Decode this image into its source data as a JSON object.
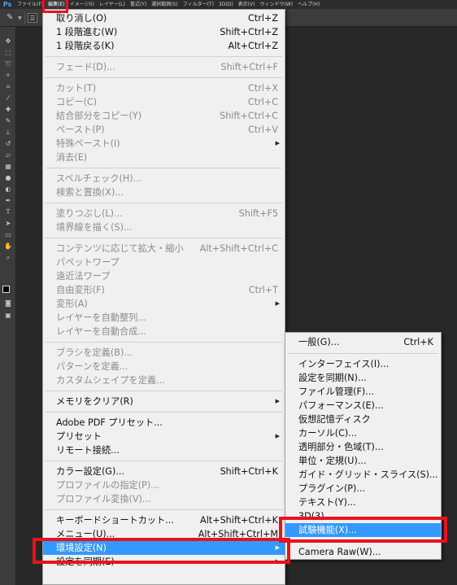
{
  "app": {
    "logo": "Ps"
  },
  "menubar": [
    {
      "label": "ファイル(F)"
    },
    {
      "label": "編集(E)",
      "active": true
    },
    {
      "label": "イメージ(I)"
    },
    {
      "label": "レイヤー(L)"
    },
    {
      "label": "書式(Y)"
    },
    {
      "label": "選択範囲(S)"
    },
    {
      "label": "フィルター(T)"
    },
    {
      "label": "3D(D)"
    },
    {
      "label": "表示(V)"
    },
    {
      "label": "ウィンドウ(W)"
    },
    {
      "label": "ヘルプ(H)"
    }
  ],
  "edit_menu": {
    "items": [
      {
        "label": "取り消し(O)",
        "shortcut": "Ctrl+Z"
      },
      {
        "label": "1 段階進む(W)",
        "shortcut": "Shift+Ctrl+Z"
      },
      {
        "label": "1 段階戻る(K)",
        "shortcut": "Alt+Ctrl+Z"
      },
      {
        "sep": true
      },
      {
        "label": "フェード(D)...",
        "shortcut": "Shift+Ctrl+F",
        "disabled": true
      },
      {
        "sep": true
      },
      {
        "label": "カット(T)",
        "shortcut": "Ctrl+X",
        "disabled": true
      },
      {
        "label": "コピー(C)",
        "shortcut": "Ctrl+C",
        "disabled": true
      },
      {
        "label": "結合部分をコピー(Y)",
        "shortcut": "Shift+Ctrl+C",
        "disabled": true
      },
      {
        "label": "ペースト(P)",
        "shortcut": "Ctrl+V",
        "disabled": true
      },
      {
        "label": "特殊ペースト(I)",
        "submenu": true,
        "disabled": true
      },
      {
        "label": "消去(E)",
        "disabled": true
      },
      {
        "sep": true
      },
      {
        "label": "スペルチェック(H)...",
        "disabled": true
      },
      {
        "label": "検索と置換(X)...",
        "disabled": true
      },
      {
        "sep": true
      },
      {
        "label": "塗りつぶし(L)...",
        "shortcut": "Shift+F5",
        "disabled": true
      },
      {
        "label": "境界線を描く(S)...",
        "disabled": true
      },
      {
        "sep": true
      },
      {
        "label": "コンテンツに応じて拡大・縮小",
        "shortcut": "Alt+Shift+Ctrl+C",
        "disabled": true
      },
      {
        "label": "パペットワープ",
        "disabled": true
      },
      {
        "label": "遠近法ワープ",
        "disabled": true
      },
      {
        "label": "自由変形(F)",
        "shortcut": "Ctrl+T",
        "disabled": true
      },
      {
        "label": "変形(A)",
        "submenu": true,
        "disabled": true
      },
      {
        "label": "レイヤーを自動整列...",
        "disabled": true
      },
      {
        "label": "レイヤーを自動合成...",
        "disabled": true
      },
      {
        "sep": true
      },
      {
        "label": "ブラシを定義(B)...",
        "disabled": true
      },
      {
        "label": "パターンを定義...",
        "disabled": true
      },
      {
        "label": "カスタムシェイプを定義...",
        "disabled": true
      },
      {
        "sep": true
      },
      {
        "label": "メモリをクリア(R)",
        "submenu": true
      },
      {
        "sep": true
      },
      {
        "label": "Adobe PDF プリセット..."
      },
      {
        "label": "プリセット",
        "submenu": true
      },
      {
        "label": "リモート接続..."
      },
      {
        "sep": true
      },
      {
        "label": "カラー設定(G)...",
        "shortcut": "Shift+Ctrl+K"
      },
      {
        "label": "プロファイルの指定(P)...",
        "disabled": true
      },
      {
        "label": "プロファイル変換(V)...",
        "disabled": true
      },
      {
        "sep": true
      },
      {
        "label": "キーボードショートカット...",
        "shortcut": "Alt+Shift+Ctrl+K"
      },
      {
        "label": "メニュー(U)...",
        "shortcut": "Alt+Shift+Ctrl+M"
      },
      {
        "label": "環境設定(N)",
        "submenu": true,
        "highlighted": true
      },
      {
        "label": "設定を同期(E)",
        "submenu": true
      }
    ]
  },
  "prefs_submenu": {
    "items": [
      {
        "label": "一般(G)...",
        "shortcut": "Ctrl+K"
      },
      {
        "sep": true
      },
      {
        "label": "インターフェイス(I)..."
      },
      {
        "label": "設定を同期(N)..."
      },
      {
        "label": "ファイル管理(F)..."
      },
      {
        "label": "パフォーマンス(E)..."
      },
      {
        "label": "仮想記憶ディスク"
      },
      {
        "label": "カーソル(C)..."
      },
      {
        "label": "透明部分・色域(T)..."
      },
      {
        "label": "単位・定規(U)..."
      },
      {
        "label": "ガイド・グリッド・スライス(S)..."
      },
      {
        "label": "プラグイン(P)..."
      },
      {
        "label": "テキスト(Y)..."
      },
      {
        "label": "3D(3)..."
      },
      {
        "label": "試験機能(X)...",
        "highlighted": true
      },
      {
        "sep": true
      },
      {
        "label": "Camera Raw(W)..."
      }
    ]
  },
  "colors": {
    "highlight": "#3399ff",
    "annotation": "#e8121e",
    "foreground_swatch": "#000000",
    "background_swatch": "#ffffff"
  },
  "icons": [
    "brush-tool-icon",
    "move-tool-icon",
    "marquee-tool-icon",
    "lasso-tool-icon",
    "crop-tool-icon",
    "eyedropper-tool-icon",
    "healing-tool-icon",
    "brush-icon",
    "stamp-tool-icon",
    "history-brush-icon",
    "eraser-tool-icon",
    "gradient-tool-icon",
    "blur-tool-icon",
    "dodge-tool-icon",
    "pen-tool-icon",
    "type-tool-icon",
    "path-select-icon",
    "shape-tool-icon",
    "hand-tool-icon",
    "zoom-tool-icon"
  ]
}
